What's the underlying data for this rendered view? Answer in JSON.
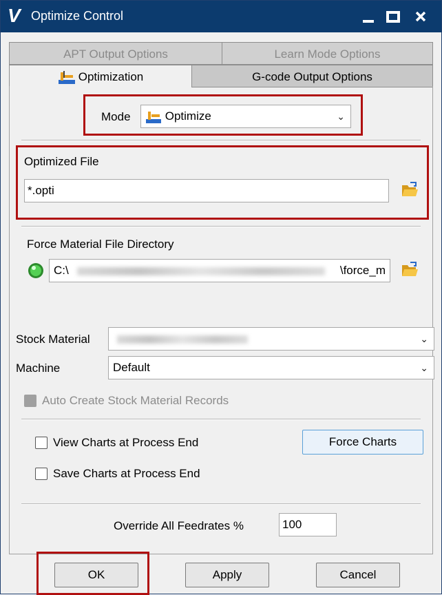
{
  "window": {
    "title": "Optimize Control",
    "app_icon_letter": "V",
    "minimize": "▁",
    "maximize": "■",
    "close": "X"
  },
  "tabs": {
    "row1": [
      "APT Output Options",
      "Learn Mode Options"
    ],
    "row2": [
      "Optimization",
      "G-code Output Options"
    ]
  },
  "mode": {
    "label": "Mode",
    "value": "Optimize"
  },
  "optimized_file": {
    "label": "Optimized File",
    "value": "*.opti"
  },
  "force_material": {
    "label": "Force Material File Directory",
    "path_start": "C:\\",
    "path_end": "\\force_m",
    "status_color": "#3cb43c"
  },
  "stock_material": {
    "label": "Stock Material",
    "value": ""
  },
  "machine": {
    "label": "Machine",
    "value": "Default"
  },
  "auto_create": {
    "label": "Auto Create Stock Material Records",
    "checked": false,
    "disabled": true
  },
  "view_charts": {
    "label": "View Charts at Process End",
    "checked": false
  },
  "save_charts": {
    "label": "Save Charts at Process End",
    "checked": false
  },
  "force_charts_button": "Force Charts",
  "override": {
    "label": "Override All Feedrates %",
    "value": "100"
  },
  "buttons": {
    "ok": "OK",
    "apply": "Apply",
    "cancel": "Cancel"
  },
  "colors": {
    "titlebar": "#0c3b6e",
    "highlight_box": "#b01010"
  }
}
